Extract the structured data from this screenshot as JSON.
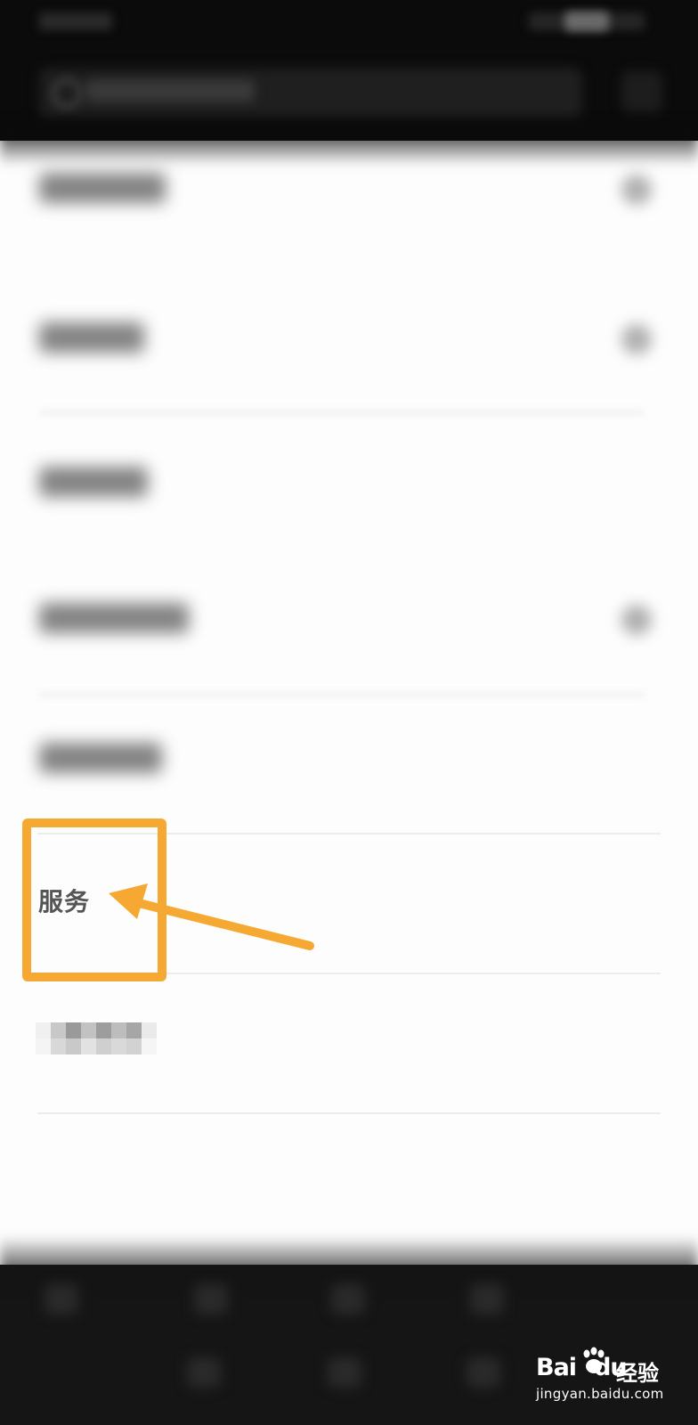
{
  "main": {
    "highlighted_item": {
      "label": "服务"
    }
  },
  "annotation": {
    "highlight_color": "#f5a933",
    "arrow_color": "#f5a933"
  },
  "watermark": {
    "brand_left": "Bai",
    "brand_right": "du",
    "product": "经验",
    "url": "jingyan.baidu.com"
  },
  "colors": {
    "header_background": "#0b0b0b",
    "bottom_bar_background": "#151515",
    "page_background": "#fdfdfd"
  }
}
